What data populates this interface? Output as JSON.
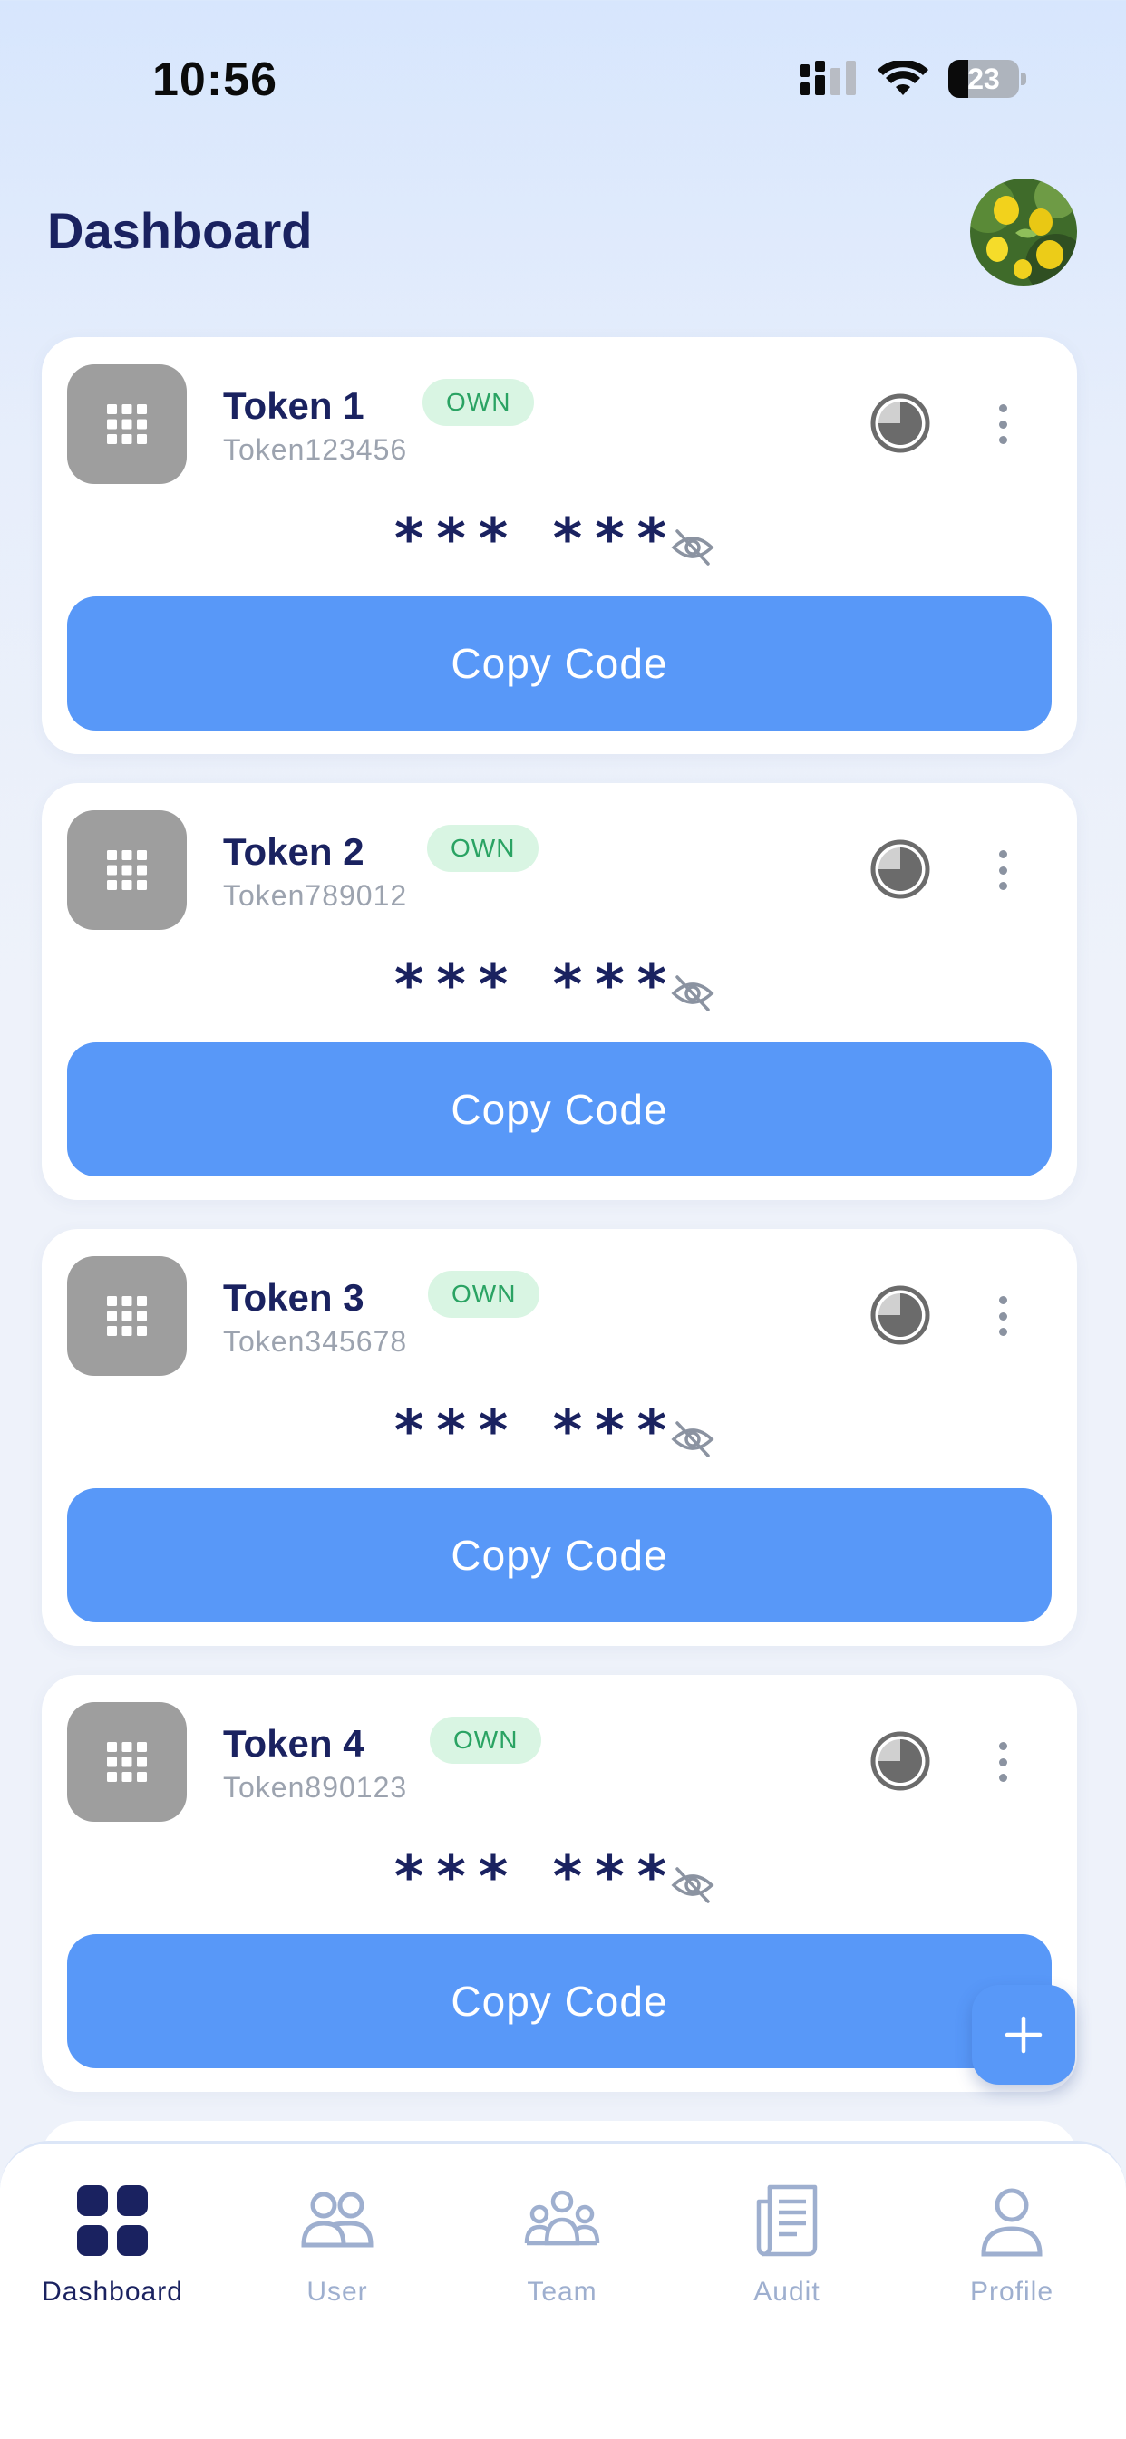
{
  "status_bar": {
    "time": "10:56",
    "battery": "23"
  },
  "header": {
    "title": "Dashboard"
  },
  "tokens": [
    {
      "name": "Token 1",
      "badge": "OWN",
      "id": "Token123456",
      "code": "*** ***",
      "copy_label": "Copy Code"
    },
    {
      "name": "Token 2",
      "badge": "OWN",
      "id": "Token789012",
      "code": "*** ***",
      "copy_label": "Copy Code"
    },
    {
      "name": "Token 3",
      "badge": "OWN",
      "id": "Token345678",
      "code": "*** ***",
      "copy_label": "Copy Code"
    },
    {
      "name": "Token 4",
      "badge": "OWN",
      "id": "Token890123",
      "code": "*** ***",
      "copy_label": "Copy Code"
    }
  ],
  "fab": {
    "icon": "plus-icon"
  },
  "nav": [
    {
      "label": "Dashboard",
      "icon": "dashboard-grid-icon",
      "active": true
    },
    {
      "label": "User",
      "icon": "users-icon",
      "active": false
    },
    {
      "label": "Team",
      "icon": "team-icon",
      "active": false
    },
    {
      "label": "Audit",
      "icon": "audit-document-icon",
      "active": false
    },
    {
      "label": "Profile",
      "icon": "profile-icon",
      "active": false
    }
  ],
  "colors": {
    "primary": "#5898f8",
    "navy": "#1a2260",
    "badge_bg": "#d9f5e3",
    "badge_text": "#2aa363",
    "inactive_nav": "#9eafcf"
  }
}
